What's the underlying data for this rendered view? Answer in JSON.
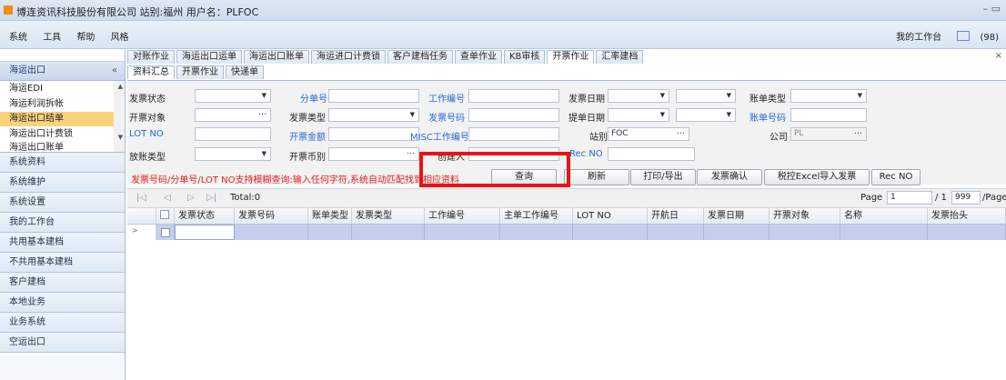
{
  "app": {
    "title": "博连资讯科技股份有限公司 站别:福州   用户名：PLFOC",
    "window_controls": "–  ▭"
  },
  "menubar": {
    "items": [
      "系统",
      "工具",
      "帮助",
      "风格"
    ],
    "workbench_label": "我的工作台",
    "mail_count": "(98)"
  },
  "sidebar": {
    "header": "海运出口",
    "collapse_glyph": "«",
    "tree_items": [
      "海运EDI",
      "海运利润拆帐",
      "海运出口结单",
      "海运出口计费锁",
      "海运出口账单"
    ],
    "selected_index": 2,
    "categories": [
      "系统资料",
      "系统维护",
      "系统设置",
      "我的工作台",
      "共用基本建档",
      "不共用基本建档",
      "客户建档",
      "本地业务",
      "业务系统",
      "空运出口"
    ]
  },
  "tabs": {
    "top": [
      "对账作业",
      "海运出口运单",
      "海运出口账单",
      "海运进口计费锁",
      "客户建档任务",
      "查单作业",
      "KB审核",
      "开票作业",
      "汇率建档"
    ],
    "top_active": 7,
    "sub": [
      "资料汇总",
      "开票作业",
      "快递单"
    ],
    "sub_active": 0,
    "close_glyph": "×"
  },
  "form": {
    "invoice_status_label": "发票状态",
    "sub_bill_no_label": "分单号",
    "job_no_label": "工作编号",
    "invoice_date_label": "发票日期",
    "bill_type_label": "账单类型",
    "invoice_target_label": "开票对象",
    "invoice_type_label": "发票类型",
    "invoice_no_label": "发票号码",
    "bl_date_label": "提单日期",
    "bill_no_label": "账单号码",
    "lot_no_label": "LOT NO",
    "invoice_amount_label": "开票金额",
    "misc_job_no_label": "MISC工作编号",
    "station_label": "站别",
    "station_value": "FOC",
    "company_label": "公司",
    "company_value": "PL",
    "account_type_label": "放账类型",
    "currency_label": "开票币别",
    "creator_label": "创建人",
    "rec_no_label": "Rec NO",
    "hint": "发票号码/分单号/LOT NO支持模糊查询:输入任何字符,系统自动匹配找到相应资料"
  },
  "buttons": {
    "query": "查询",
    "refresh": "刷新",
    "print_export": "打印/导出",
    "invoice_confirm": "发票确认",
    "tax_import": "税控Excel导入发票",
    "rec_no": "Rec NO"
  },
  "pager": {
    "total": "Total:0",
    "page_label": "Page",
    "page_value": "1",
    "of_label": "/ 1",
    "page_size": "999",
    "per_page_label": "/Page"
  },
  "grid": {
    "columns": [
      "发票状态",
      "发票号码",
      "账单类型",
      "发票类型",
      "工作编号",
      "主单工作编号",
      "LOT NO",
      "开航日",
      "发票日期",
      "开票对象",
      "名称",
      "发票抬头"
    ]
  }
}
